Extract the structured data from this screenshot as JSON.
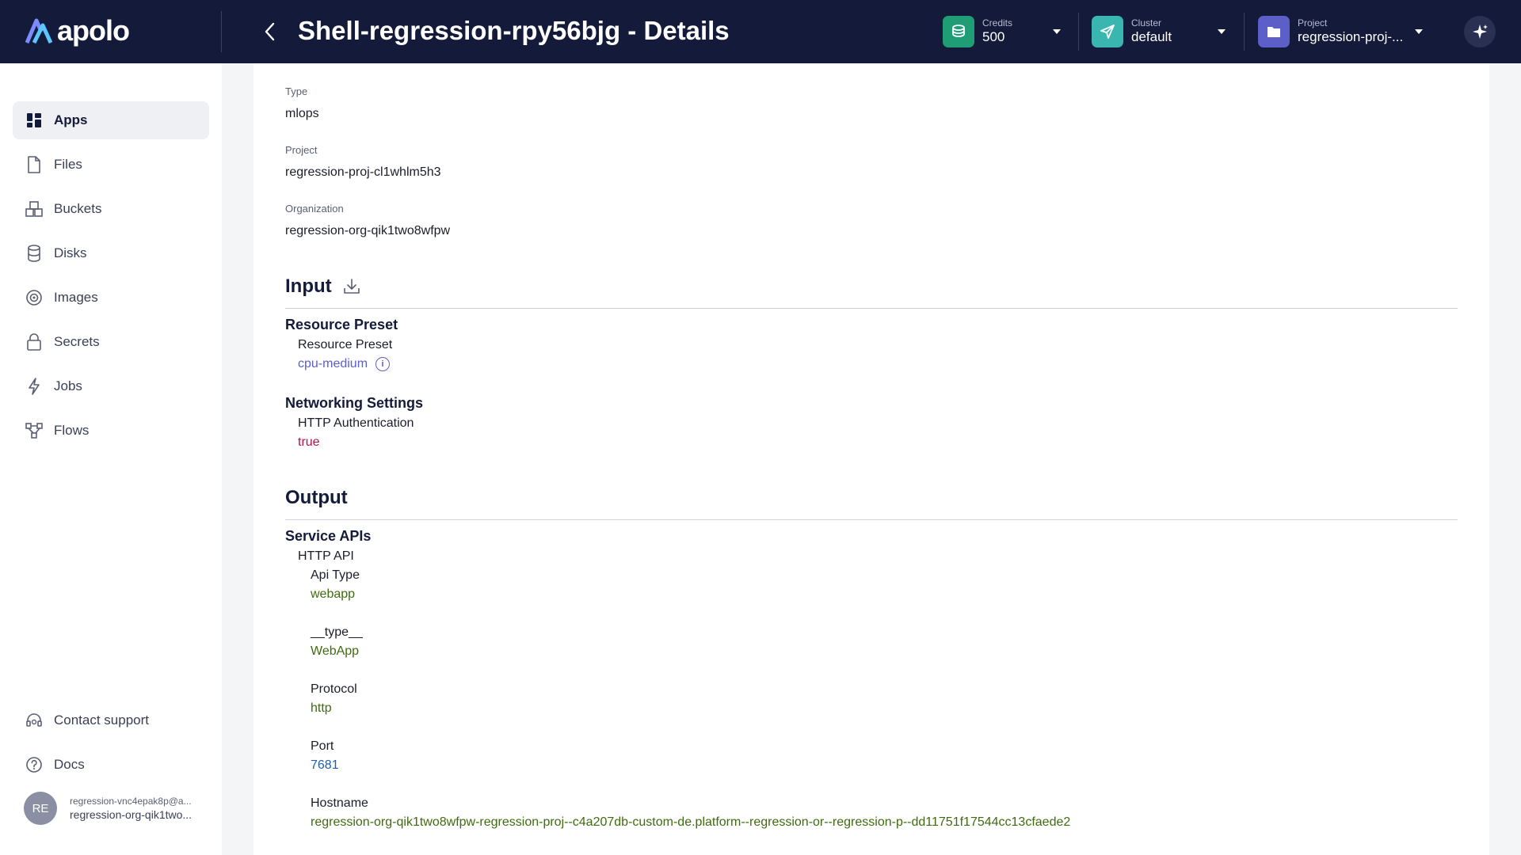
{
  "app": {
    "logo_text": "apolo",
    "page_title": "Shell-regression-rpy56bjg - Details"
  },
  "header": {
    "credits": {
      "label": "Credits",
      "value": "500",
      "icon": "coins-icon",
      "color": "#1f9d74"
    },
    "cluster": {
      "label": "Cluster",
      "value": "default",
      "icon": "send-icon",
      "color": "#3ab6b0"
    },
    "project": {
      "label": "Project",
      "value": "regression-proj-...",
      "icon": "folder-icon",
      "color": "#5b5fc7"
    },
    "assistant_icon": "sparkles-icon"
  },
  "sidebar": {
    "items": [
      {
        "label": "Apps",
        "icon": "apps-grid-icon",
        "active": true
      },
      {
        "label": "Files",
        "icon": "file-icon"
      },
      {
        "label": "Buckets",
        "icon": "buckets-icon"
      },
      {
        "label": "Disks",
        "icon": "database-icon"
      },
      {
        "label": "Images",
        "icon": "disc-icon"
      },
      {
        "label": "Secrets",
        "icon": "lock-icon"
      },
      {
        "label": "Jobs",
        "icon": "lightning-icon"
      },
      {
        "label": "Flows",
        "icon": "flow-icon"
      }
    ],
    "bottom": [
      {
        "label": "Contact support",
        "icon": "headset-icon"
      },
      {
        "label": "Docs",
        "icon": "help-circle-icon"
      }
    ],
    "user": {
      "initials": "RE",
      "email": "regression-vnc4epak8p@a...",
      "org": "regression-org-qik1two..."
    }
  },
  "details": {
    "type_label": "Type",
    "type_value": "mlops",
    "project_label": "Project",
    "project_value": "regression-proj-cl1whlm5h3",
    "org_label": "Organization",
    "org_value": "regression-org-qik1two8wfpw"
  },
  "input": {
    "title": "Input",
    "resource_preset_group": "Resource Preset",
    "resource_preset_label": "Resource Preset",
    "resource_preset_value": "cpu-medium",
    "networking_group": "Networking Settings",
    "http_auth_label": "HTTP Authentication",
    "http_auth_value": "true"
  },
  "output": {
    "title": "Output",
    "service_apis_group": "Service APIs",
    "http_api_label": "HTTP API",
    "api_type_label": "Api Type",
    "api_type_value": "webapp",
    "type_label": "__type__",
    "type_value": "WebApp",
    "protocol_label": "Protocol",
    "protocol_value": "http",
    "port_label": "Port",
    "port_value": "7681",
    "hostname_label": "Hostname",
    "hostname_value": "regression-org-qik1two8wfpw-regression-proj--c4a207db-custom-de.platform--regression-or--regression-p--dd11751f17544cc13cfaede2"
  }
}
